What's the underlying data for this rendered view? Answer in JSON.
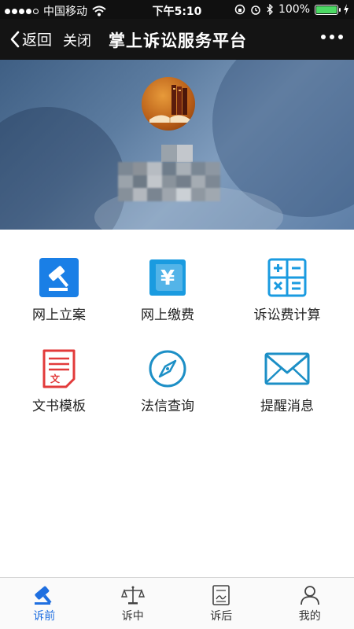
{
  "status_bar": {
    "carrier": "中国移动",
    "time": "下午5:10",
    "battery": "100%",
    "battery_level": 1.0
  },
  "nav": {
    "back_label": "返回",
    "close_label": "关闭",
    "title": "掌上诉讼服务平台"
  },
  "services": [
    {
      "label": "网上立案",
      "icon": "gavel-icon"
    },
    {
      "label": "网上缴费",
      "icon": "yuan-scroll-icon"
    },
    {
      "label": "诉讼费计算",
      "icon": "calculator-icon"
    },
    {
      "label": "文书模板",
      "icon": "document-template-icon"
    },
    {
      "label": "法信查询",
      "icon": "compass-icon"
    },
    {
      "label": "提醒消息",
      "icon": "envelope-icon"
    }
  ],
  "tabs": [
    {
      "label": "诉前",
      "icon": "gavel-icon",
      "active": true
    },
    {
      "label": "诉中",
      "icon": "scales-icon",
      "active": false
    },
    {
      "label": "诉后",
      "icon": "certificate-icon",
      "active": false
    },
    {
      "label": "我的",
      "icon": "user-icon",
      "active": false
    }
  ],
  "colors": {
    "accent_blue": "#1f6fe0",
    "icon_blue": "#1a9be0",
    "icon_red": "#e23a3a",
    "icon_teal": "#1c8fc6"
  }
}
